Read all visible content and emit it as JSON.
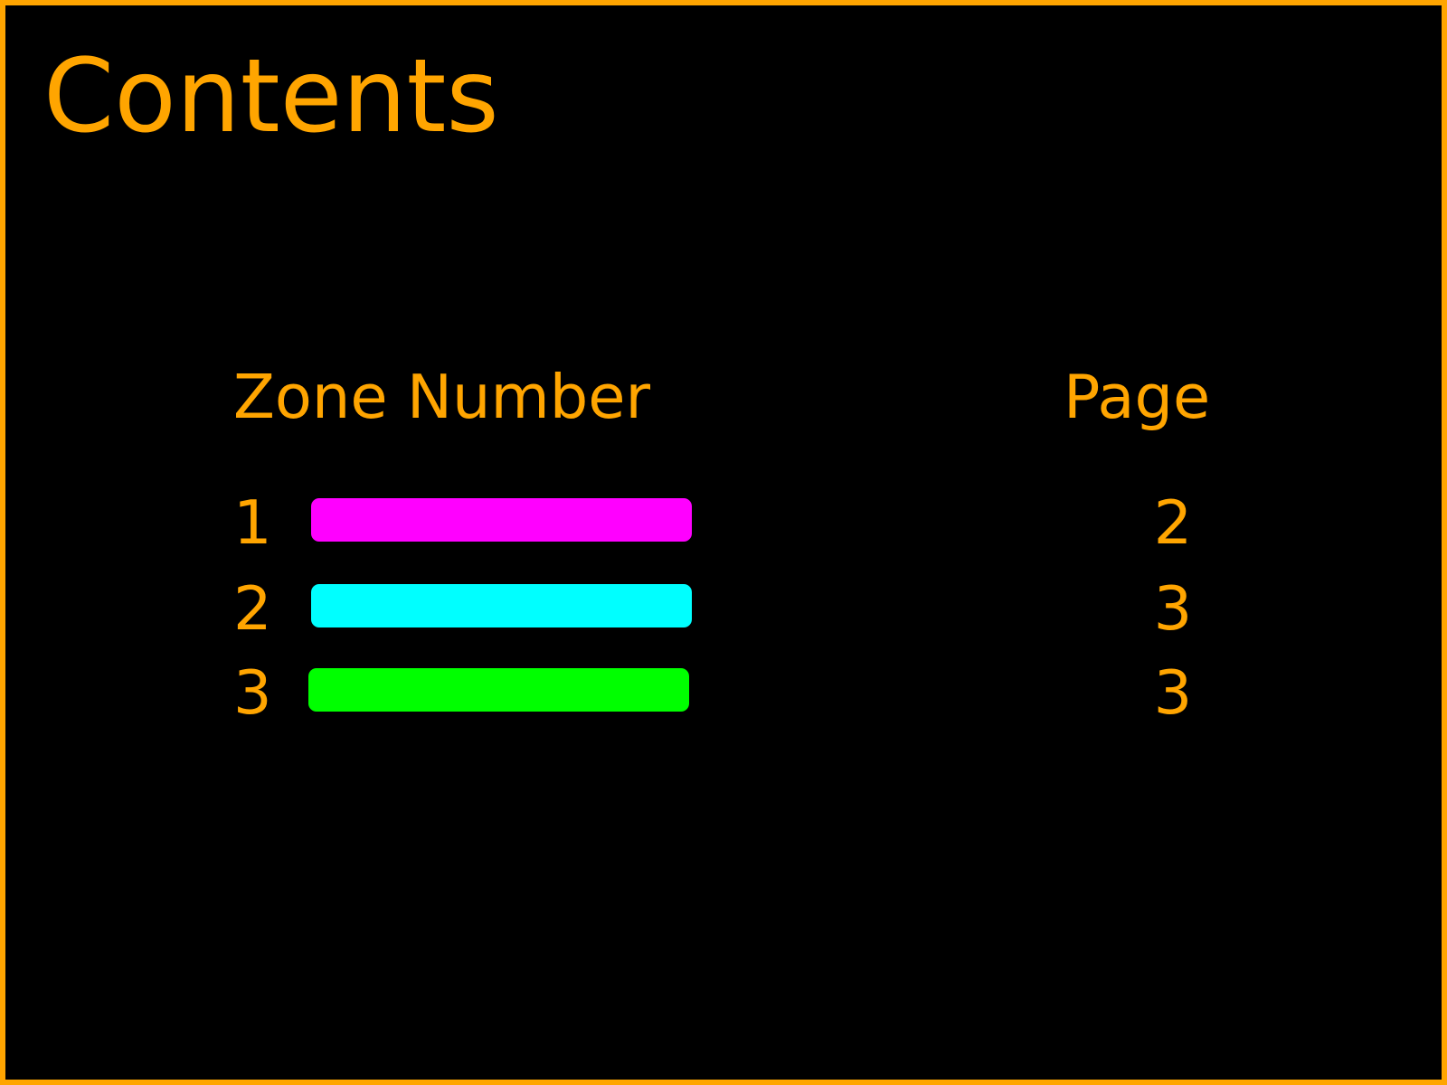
{
  "title": "Contents",
  "colors": {
    "accent": "#FFA500",
    "background": "#000000"
  },
  "table": {
    "zone_header": "Zone Number",
    "page_header": "Page",
    "rows": [
      {
        "zone": "1",
        "color": "#FF00FF",
        "page": "2"
      },
      {
        "zone": "2",
        "color": "#00FFFF",
        "page": "3"
      },
      {
        "zone": "3",
        "color": "#00FF00",
        "page": "3"
      }
    ]
  }
}
